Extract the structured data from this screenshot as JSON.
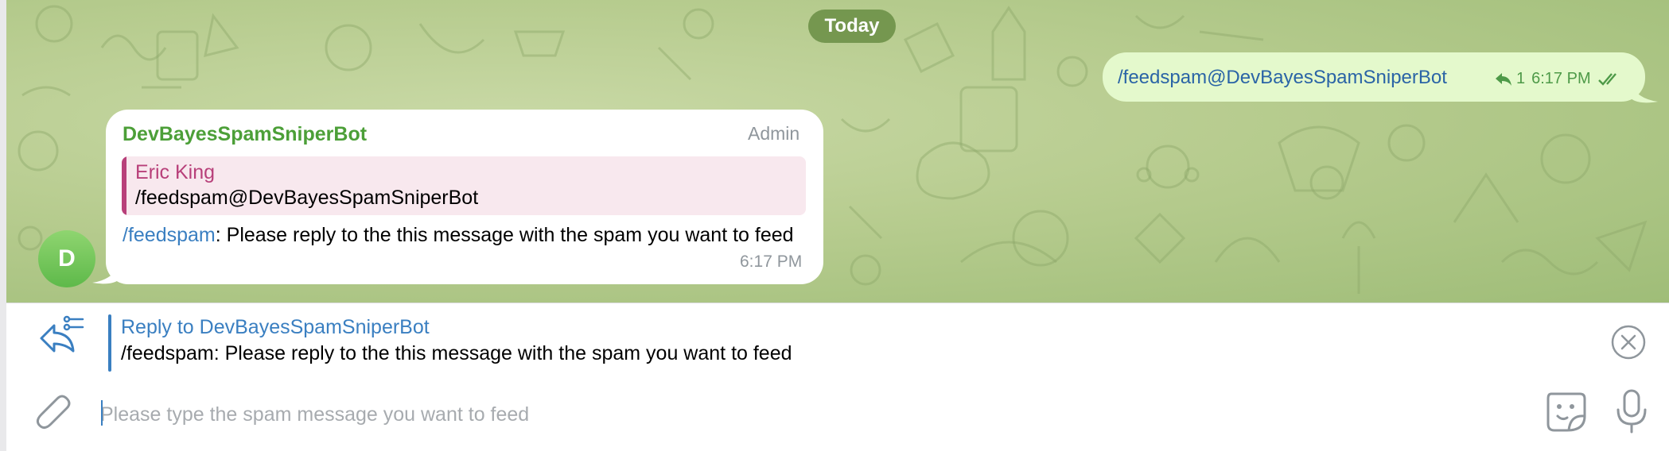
{
  "date_separator": "Today",
  "outgoing_message": {
    "text": "/feedspam@DevBayesSpamSniperBot",
    "reply_count": "1",
    "time": "6:17 PM"
  },
  "incoming_message": {
    "sender": "DevBayesSpamSniperBot",
    "role_badge": "Admin",
    "quoted_name": "Eric King",
    "quoted_text": "/feedspam@DevBayesSpamSniperBot",
    "command": "/feedspam",
    "body": ": Please reply to the this message with the spam you want to feed",
    "time": "6:17 PM",
    "avatar_letter": "D"
  },
  "reply_panel": {
    "title": "Reply to DevBayesSpamSniperBot",
    "text": "/feedspam: Please reply to the this message with the spam you want to feed"
  },
  "composer": {
    "placeholder": "Please type the spam message you want to feed",
    "value": ""
  },
  "icons": {
    "reply_options": "reply-arrow-icon",
    "close": "close-circle-icon",
    "attach": "paperclip-icon",
    "sticker": "sticker-icon",
    "mic": "microphone-icon"
  },
  "colors": {
    "accent_blue": "#3a7fc1",
    "sender_green": "#4c9f38",
    "quote_pink": "#b8407a",
    "outgoing_bubble": "#e4f9cc",
    "chat_background": "#b7cc8f"
  }
}
